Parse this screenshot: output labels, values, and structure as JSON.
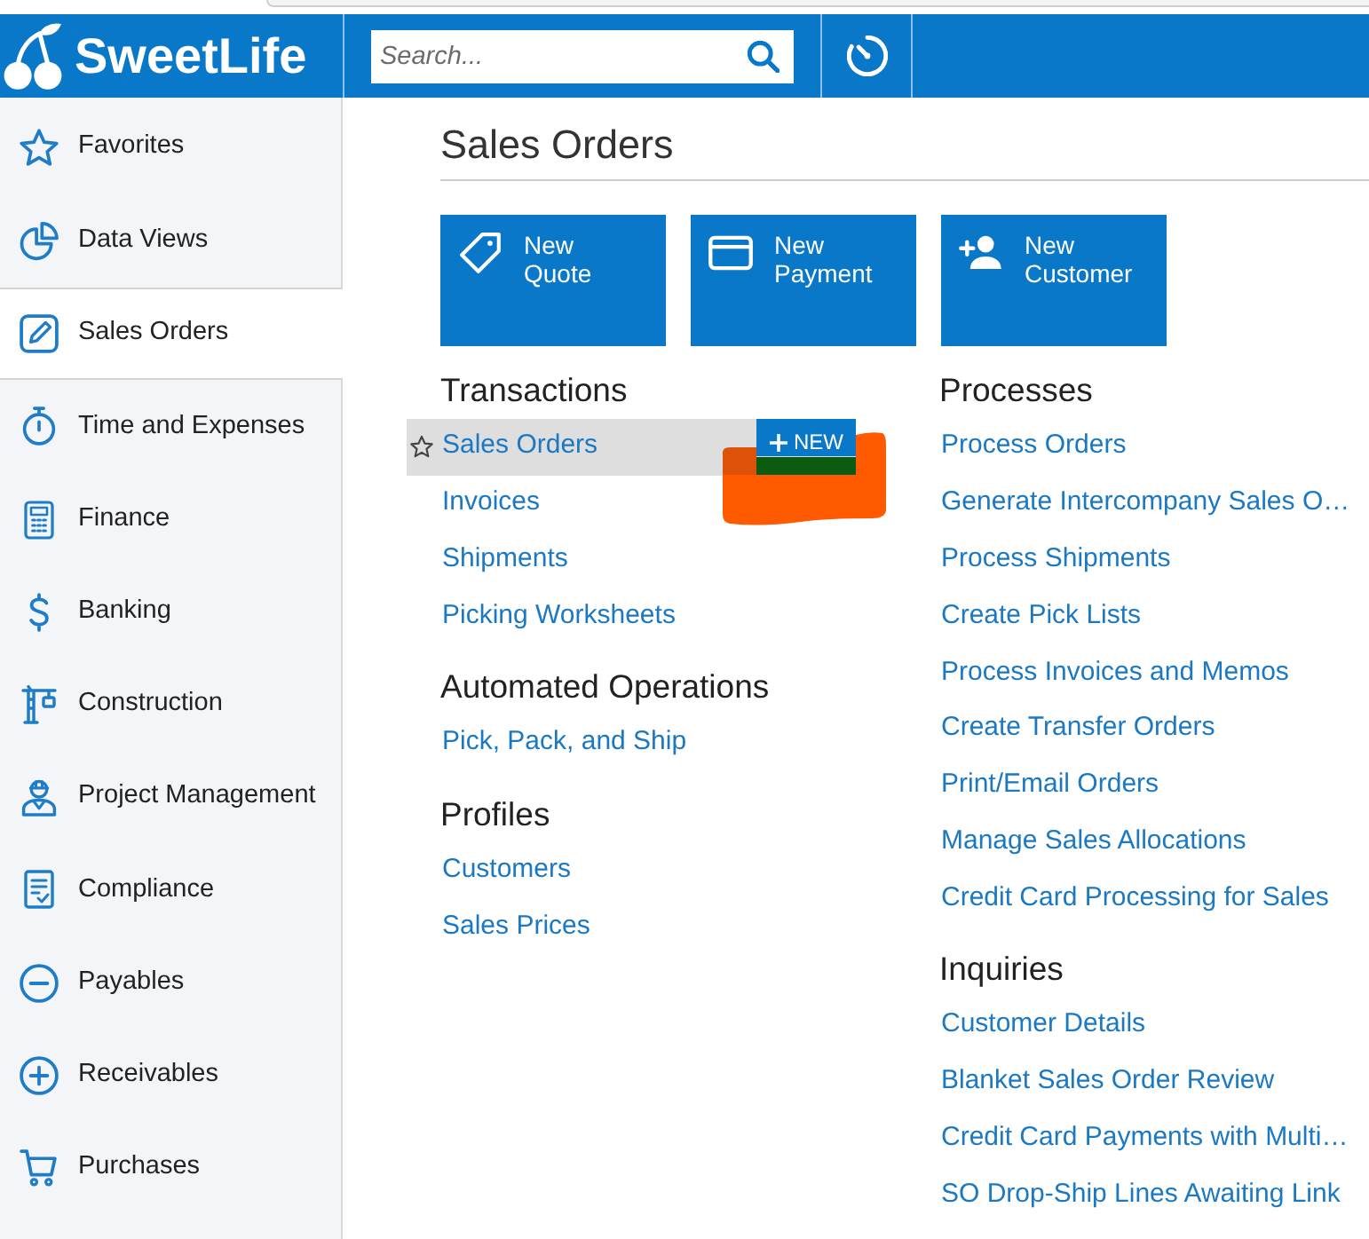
{
  "header": {
    "logo": "SweetLife",
    "search": {
      "placeholder": "Search..."
    }
  },
  "sidebar": {
    "items": [
      {
        "label": "Favorites",
        "selected": false
      },
      {
        "label": "Data Views",
        "selected": false
      },
      {
        "label": "Sales Orders",
        "selected": true
      },
      {
        "label": "Time and Expenses",
        "selected": false
      },
      {
        "label": "Finance",
        "selected": false
      },
      {
        "label": "Banking",
        "selected": false
      },
      {
        "label": "Construction",
        "selected": false
      },
      {
        "label": "Project Management",
        "selected": false
      },
      {
        "label": "Compliance",
        "selected": false
      },
      {
        "label": "Payables",
        "selected": false
      },
      {
        "label": "Receivables",
        "selected": false
      },
      {
        "label": "Purchases",
        "selected": false
      }
    ]
  },
  "page": {
    "title": "Sales Orders"
  },
  "tiles": [
    {
      "label": "New Quote"
    },
    {
      "label": "New Payment"
    },
    {
      "label": "New Customer"
    }
  ],
  "columns": [
    {
      "sections": [
        {
          "heading": "Transactions",
          "links": [
            {
              "label": "Sales Orders",
              "highlighted": true,
              "action": "NEW"
            },
            {
              "label": "Invoices",
              "highlighted": false
            },
            {
              "label": "Shipments",
              "highlighted": false
            },
            {
              "label": "Picking Worksheets",
              "highlighted": false
            }
          ]
        },
        {
          "heading": "Automated Operations",
          "links": [
            {
              "label": "Pick, Pack, and Ship",
              "highlighted": false
            }
          ]
        },
        {
          "heading": "Profiles",
          "links": [
            {
              "label": "Customers",
              "highlighted": false
            },
            {
              "label": "Sales Prices",
              "highlighted": false
            }
          ]
        }
      ]
    },
    {
      "sections": [
        {
          "heading": "Processes",
          "links": [
            {
              "label": "Process Orders",
              "highlighted": false
            },
            {
              "label": "Generate Intercompany Sales O…",
              "highlighted": false
            },
            {
              "label": "Process Shipments",
              "highlighted": false
            },
            {
              "label": "Create Pick Lists",
              "highlighted": false
            },
            {
              "label": "Process Invoices and Memos",
              "highlighted": false
            },
            {
              "label": "Create Transfer Orders",
              "highlighted": false
            },
            {
              "label": "Print/Email Orders",
              "highlighted": false
            },
            {
              "label": "Manage Sales Allocations",
              "highlighted": false
            },
            {
              "label": "Credit Card Processing for Sales",
              "highlighted": false
            }
          ]
        },
        {
          "heading": "Inquiries",
          "links": [
            {
              "label": "Customer Details",
              "highlighted": false
            },
            {
              "label": "Blanket Sales Order Review",
              "highlighted": false
            },
            {
              "label": "Credit Card Payments with Multi…",
              "highlighted": false
            },
            {
              "label": "SO Drop-Ship Lines Awaiting Link",
              "highlighted": false
            }
          ]
        }
      ]
    }
  ]
}
